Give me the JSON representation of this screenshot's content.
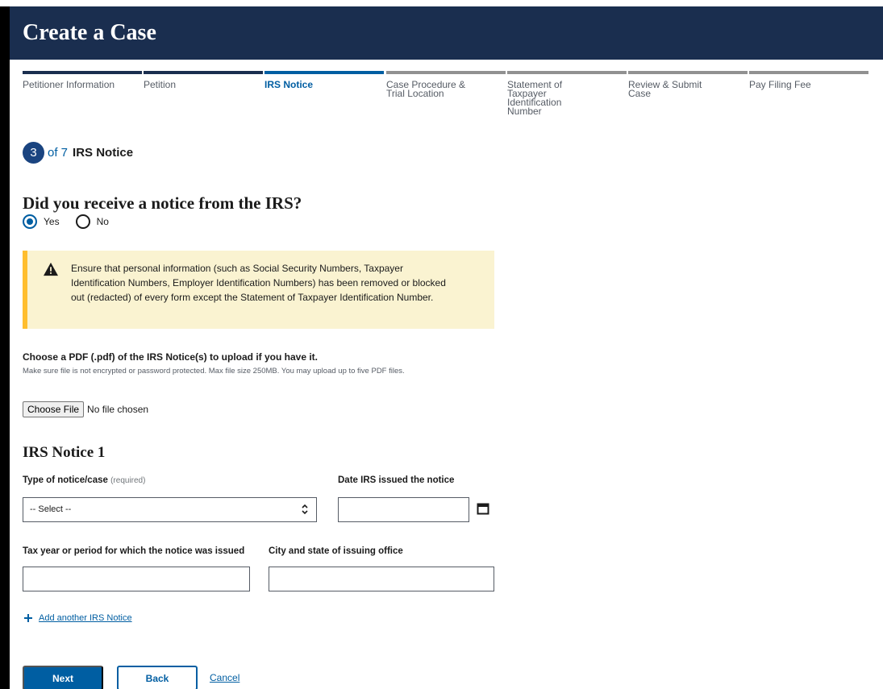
{
  "header": {
    "title": "Create a Case"
  },
  "stepper": {
    "steps": [
      {
        "label": "Petitioner Information",
        "state": "done"
      },
      {
        "label": "Petition",
        "state": "done"
      },
      {
        "label": "IRS Notice",
        "state": "current"
      },
      {
        "label": "Case Procedure & Trial Location",
        "state": "upcoming"
      },
      {
        "label": "Statement of Taxpayer Identification Number",
        "state": "upcoming"
      },
      {
        "label": "Review & Submit Case",
        "state": "upcoming"
      },
      {
        "label": "Pay Filing Fee",
        "state": "upcoming"
      }
    ]
  },
  "step_counter": {
    "current": "3",
    "of_text": "of 7",
    "name": "IRS Notice"
  },
  "question": {
    "text": "Did you receive a notice from the IRS?",
    "options": [
      {
        "label": "Yes",
        "checked": true
      },
      {
        "label": "No",
        "checked": false
      }
    ]
  },
  "alert": {
    "icon": "warning-icon",
    "text": "Ensure that personal information (such as Social Security Numbers, Taxpayer Identification Numbers, Employer Identification Numbers) has been removed or blocked out (redacted) of every form except the Statement of Taxpayer Identification Number."
  },
  "upload": {
    "label": "Choose a PDF (.pdf) of the IRS Notice(s) to upload if you have it.",
    "hint": "Make sure file is not encrypted or password protected. Max file size 250MB. You may upload up to five PDF files.",
    "button_label": "Choose File",
    "status": "No file chosen"
  },
  "notice": {
    "heading": "IRS Notice 1",
    "type_label": "Type of notice/case",
    "type_required": "(required)",
    "type_value": "-- Select --",
    "date_label": "Date IRS issued the notice",
    "date_value": "",
    "tax_year_label": "Tax year or period for which the notice was issued",
    "tax_year_value": "",
    "city_label": "City and state of issuing office",
    "city_value": ""
  },
  "add_link": "Add another IRS Notice",
  "actions": {
    "next": "Next",
    "back": "Back",
    "cancel": "Cancel"
  },
  "colors": {
    "header_bg": "#1a2e4f",
    "accent": "#005ea2",
    "alert_bg": "#faf3d1",
    "alert_border": "#ffbe2e"
  }
}
